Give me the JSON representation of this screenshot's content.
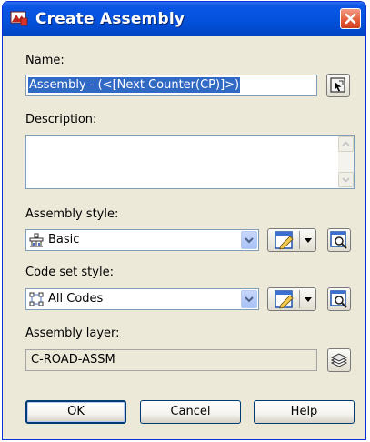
{
  "window": {
    "title": "Create Assembly",
    "title_bar_color": "#0352dc",
    "close_button_color": "#e25a36"
  },
  "name": {
    "label": "Name:",
    "value": "Assembly - (<[Next Counter(CP)]>)",
    "selection_color": "#316ac5",
    "pick_icon": "name-template-pick-icon"
  },
  "description": {
    "label": "Description:",
    "value": ""
  },
  "assembly_style": {
    "label": "Assembly style:",
    "value": "Basic",
    "icon": "assembly-style-icon"
  },
  "code_set_style": {
    "label": "Code set style:",
    "value": "All Codes",
    "icon": "code-set-icon"
  },
  "assembly_layer": {
    "label": "Assembly layer:",
    "value": "C-ROAD-ASSM",
    "icon": "layer-stack-icon"
  },
  "buttons": {
    "ok": "OK",
    "cancel": "Cancel",
    "help": "Help"
  }
}
